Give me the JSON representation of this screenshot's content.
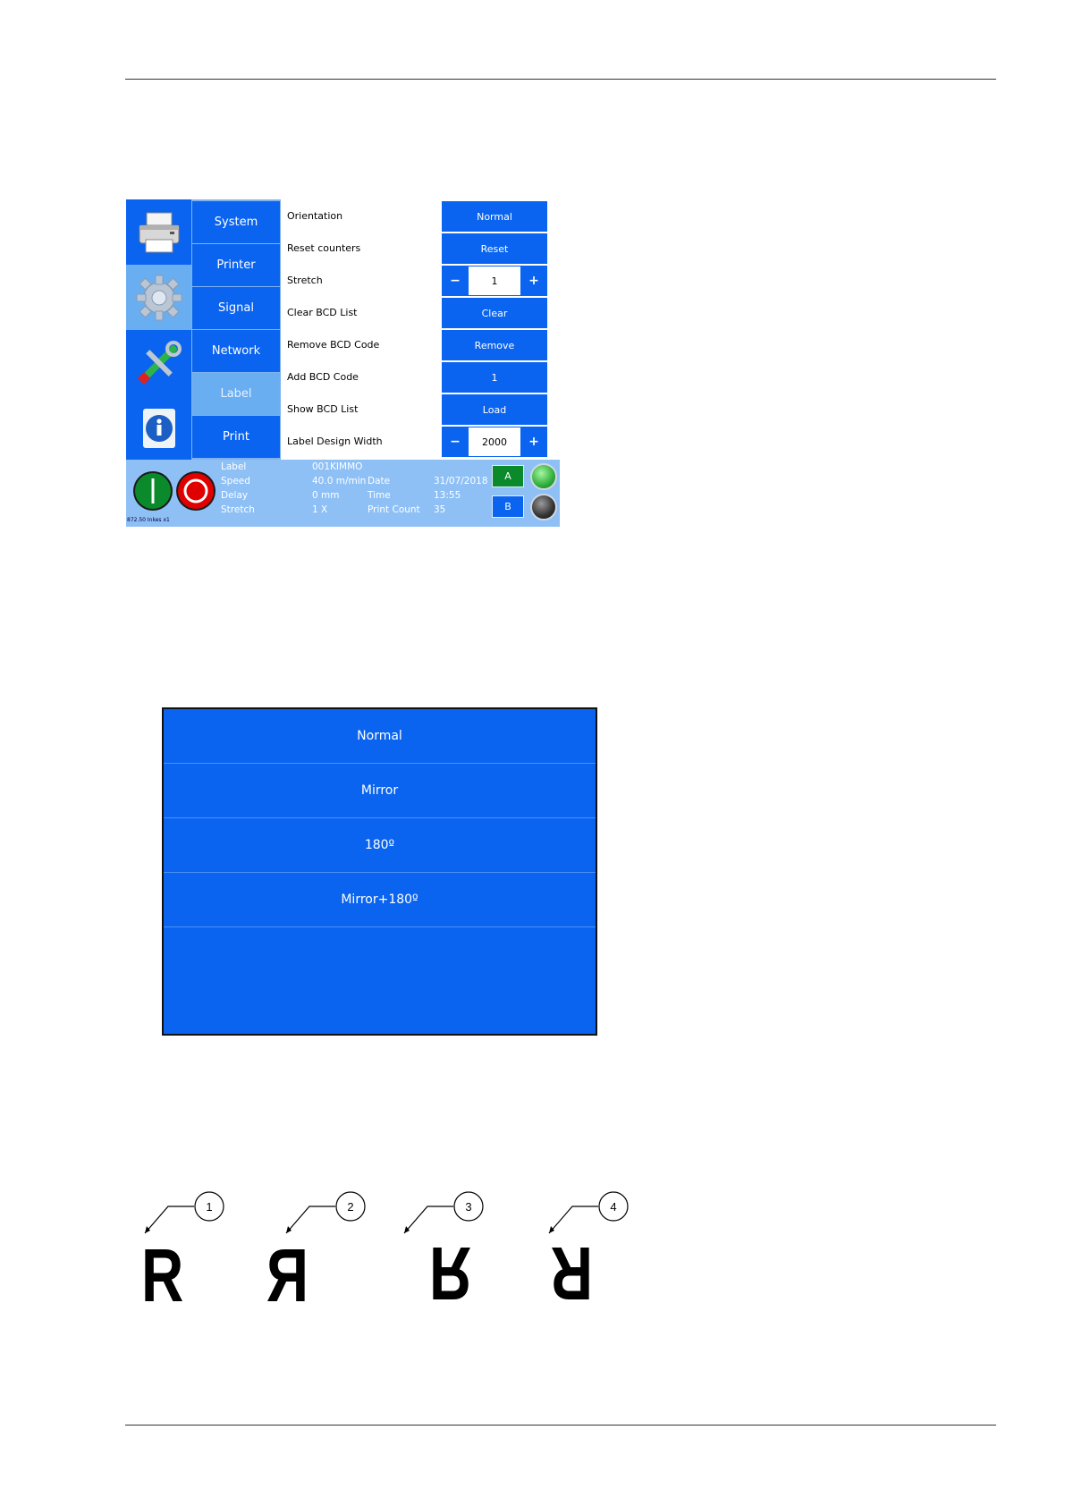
{
  "colors": {
    "accent": "#0a64f0",
    "selected": "#6aaef2",
    "status_bar": "#8ec0f6",
    "green": "#0a8a2a",
    "red": "#e00000"
  },
  "screen": {
    "icons": [
      {
        "name": "printer-icon"
      },
      {
        "name": "gear-icon",
        "selected": true
      },
      {
        "name": "tools-icon"
      },
      {
        "name": "info-icon"
      }
    ],
    "menu": [
      "System",
      "Printer",
      "Signal",
      "Network",
      "Label",
      "Print"
    ],
    "active_menu": "Label",
    "settings": {
      "orientation": {
        "label": "Orientation",
        "button": "Normal"
      },
      "reset_counters": {
        "label": "Reset counters",
        "button": "Reset"
      },
      "stretch": {
        "label": "Stretch",
        "minus": "−",
        "value": "1",
        "plus": "+"
      },
      "clear_bcd_list": {
        "label": "Clear BCD List",
        "button": "Clear"
      },
      "remove_bcd_code": {
        "label": "Remove BCD Code",
        "button": "Remove"
      },
      "add_bcd_code": {
        "label": "Add BCD Code",
        "button": "1"
      },
      "show_bcd_list": {
        "label": "Show BCD List",
        "button": "Load"
      },
      "label_design_width": {
        "label": "Label Design Width",
        "minus": "−",
        "value": "2000",
        "plus": "+"
      }
    },
    "status": {
      "label_key": "Label",
      "label_value": "001KIMMO",
      "speed_key": "Speed",
      "speed_value": "40.0 m/min",
      "delay_key": "Delay",
      "delay_value": "0 mm",
      "stretch_key": "Stretch",
      "stretch_value": "1 X",
      "date_key": "Date",
      "date_value": "31/07/2018",
      "time_key": "Time",
      "time_value": "13:55",
      "count_key": "Print Count",
      "count_value": "35",
      "a_label": "A",
      "b_label": "B",
      "footer": "872.50 Inkes x1"
    }
  },
  "orientation_menu": {
    "options": [
      "Normal",
      "Mirror",
      "180º",
      "Mirror+180º"
    ]
  },
  "figure": {
    "callouts": [
      "1",
      "2",
      "3",
      "4"
    ],
    "glyph": "R"
  }
}
